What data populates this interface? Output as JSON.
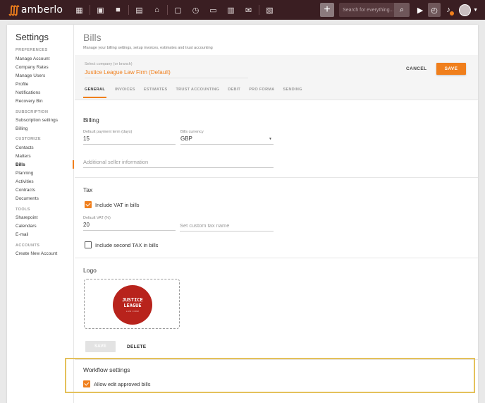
{
  "topbar": {
    "logo_text": "amberlo",
    "search_placeholder": "Search for everything...",
    "plus_label": "+"
  },
  "sidebar": {
    "title": "Settings",
    "sections": [
      {
        "label": "PREFERENCES",
        "items": [
          "Manage Account",
          "Company Rates",
          "Manage Users",
          "Profile",
          "Notifications",
          "Recovery Bin"
        ]
      },
      {
        "label": "SUBSCRIPTION",
        "items": [
          "Subscription settings",
          "Billing"
        ]
      },
      {
        "label": "CUSTOMIZE",
        "items": [
          "Contacts",
          "Matters",
          "Bills",
          "Planning",
          "Activities",
          "Contracts",
          "Documents"
        ]
      },
      {
        "label": "TOOLS",
        "items": [
          "Sharepoint",
          "Calendars",
          "E-mail"
        ]
      },
      {
        "label": "ACCOUNTS",
        "items": [
          "Create New Account"
        ]
      }
    ],
    "active_item": "Bills"
  },
  "header": {
    "title": "Bills",
    "subtitle": "Manage your billing settings, setup invoices, estimates and trust accounting"
  },
  "company": {
    "label": "Select company (or branch)",
    "value": "Justice League Law Firm (Default)",
    "cancel_label": "CANCEL",
    "save_label": "SAVE"
  },
  "tabs": [
    {
      "label": "GENERAL",
      "active": true
    },
    {
      "label": "INVOICES",
      "active": false
    },
    {
      "label": "ESTIMATES",
      "active": false
    },
    {
      "label": "TRUST ACCOUNTING",
      "active": false
    },
    {
      "label": "DEBIT",
      "active": false
    },
    {
      "label": "PRO FORMA",
      "active": false
    },
    {
      "label": "SENDING",
      "active": false
    }
  ],
  "billing": {
    "title": "Billing",
    "payment_term_label": "Default payment term (days)",
    "payment_term_value": "15",
    "currency_label": "Bills currency",
    "currency_value": "GBP",
    "seller_info_placeholder": "Additional seller information"
  },
  "tax": {
    "title": "Tax",
    "include_vat_label": "Include VAT in bills",
    "include_vat_checked": true,
    "default_vat_label": "Default VAT (%)",
    "default_vat_value": "20",
    "custom_tax_placeholder": "Set custom tax name",
    "second_tax_label": "Include second TAX in bills",
    "second_tax_checked": false
  },
  "logo": {
    "title": "Logo",
    "line1": "JUSTICE",
    "line2": "LEAGUE",
    "line3": "LAW FIRM",
    "save_label": "SAVE",
    "delete_label": "DELETE"
  },
  "workflow": {
    "title": "Workflow settings",
    "allow_edit_label": "Allow edit approved bills",
    "allow_edit_checked": true
  },
  "colors": {
    "accent": "#f07f1c",
    "topbar": "#3a1e22",
    "highlight": "#e4c15b"
  }
}
